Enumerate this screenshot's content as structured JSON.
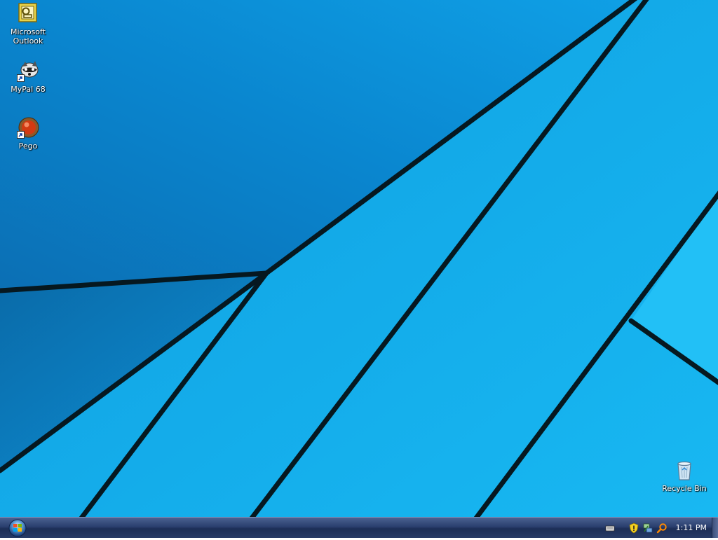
{
  "desktop": {
    "icons": [
      {
        "id": "microsoft-outlook",
        "label": "Microsoft\nOutlook",
        "icon": "outlook-icon",
        "shortcut": false
      },
      {
        "id": "mypal-68",
        "label": "MyPal 68",
        "icon": "raccoon-icon",
        "shortcut": true
      },
      {
        "id": "pego",
        "label": "Pego",
        "icon": "pego-icon",
        "shortcut": true
      },
      {
        "id": "recycle-bin",
        "label": "Recycle Bin",
        "icon": "recycle-bin-icon",
        "shortcut": false
      }
    ]
  },
  "taskbar": {
    "start_icon": "windows-orb-icon",
    "tray_icons": [
      "keyboard-icon",
      "security-shield-icon",
      "network-icon",
      "search-icon"
    ],
    "clock": "1:11 PM"
  },
  "colors": {
    "wallpaper_light": "#14b4f0",
    "wallpaper_dark": "#0a70b8",
    "taskbar": "#2a3f6e"
  }
}
